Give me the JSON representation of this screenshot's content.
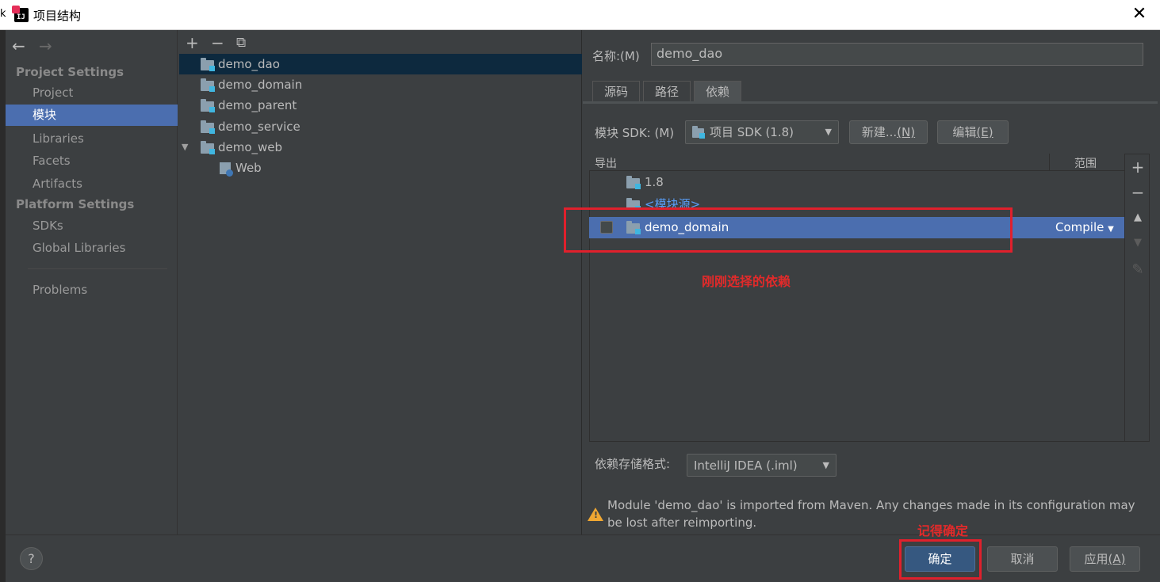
{
  "window": {
    "title": "项目结构",
    "left_edge_char": "k",
    "close": "✕"
  },
  "nav": {
    "back": "←",
    "forward": "→",
    "project_settings": "Project Settings",
    "project_items": [
      "Project",
      "模块",
      "Libraries",
      "Facets",
      "Artifacts"
    ],
    "platform_settings": "Platform Settings",
    "platform_items": [
      "SDKs",
      "Global Libraries"
    ],
    "problems": "Problems"
  },
  "tree": {
    "toolbar": {
      "add": "+",
      "remove": "−",
      "copy": "⧉"
    },
    "modules": [
      "demo_dao",
      "demo_domain",
      "demo_parent",
      "demo_service",
      "demo_web"
    ],
    "web_expand": "▼",
    "web_child": "Web"
  },
  "details": {
    "name_label": "名称:(M)",
    "name_value": "demo_dao",
    "tabs": [
      "源码",
      "路径",
      "依赖"
    ],
    "sdk_label": "模块 SDK:  (M)",
    "sdk_value": "项目 SDK (1.8)",
    "new_button": "新建...",
    "new_mnemonic": "(N)",
    "edit_button": "编辑",
    "edit_mnemonic": "(E)",
    "table": {
      "col_export": "导出",
      "col_scope": "范围",
      "rows": [
        {
          "name": "1.8"
        },
        {
          "name": "<模块源>"
        },
        {
          "name": "demo_domain",
          "scope": "Compile"
        }
      ]
    },
    "side": {
      "add": "+",
      "remove": "−",
      "up": "▲",
      "down": "▼",
      "edit": "✎"
    },
    "format_label": "依赖存储格式:",
    "format_value": "IntelliJ IDEA (.iml)",
    "warning": "Module 'demo_dao' is imported from Maven. Any changes made in its configuration may be lost after reimporting."
  },
  "annotations": {
    "selected_dep": "刚刚选择的依赖",
    "remember_ok": "记得确定"
  },
  "buttons": {
    "help": "?",
    "ok": "确定",
    "cancel": "取消",
    "apply": "应用",
    "apply_mnemonic": "(A)"
  },
  "colors": {
    "background": "#3c3f41",
    "selection": "#4b6eaf",
    "tree_selection": "#0d293e",
    "annotation_red": "#e0202c",
    "warning": "#f0a732"
  }
}
